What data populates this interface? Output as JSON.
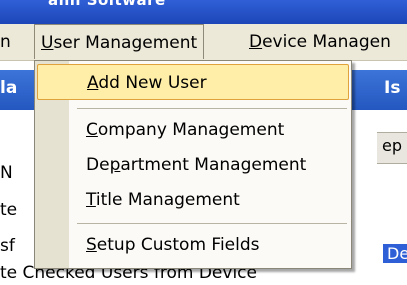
{
  "window": {
    "title_fragment": "ann Soitware"
  },
  "menubar": {
    "left_fragment": "n",
    "user_management": {
      "access": "U",
      "rest": "ser Management"
    },
    "device_management": {
      "access": "D",
      "rest": "evice Managen"
    }
  },
  "background": {
    "band_left": "la",
    "band_right": "Is",
    "row_n": "N",
    "row_te": "te",
    "row_sf": "sf",
    "row_ep": "ep",
    "row_de": "De",
    "bottom_text": "te Checked Users from Device"
  },
  "dropdown": {
    "items": [
      {
        "access": "A",
        "rest": "dd New User"
      },
      {
        "access": "C",
        "rest": "ompany Management"
      },
      {
        "pre": "De",
        "access": "p",
        "rest": "artment Management"
      },
      {
        "access": "T",
        "rest": "itle Management"
      },
      {
        "access": "S",
        "rest": "etup Custom Fields"
      }
    ]
  },
  "colors": {
    "title_blue": "#1d47b8",
    "highlight_fill": "#ffeea8",
    "highlight_border": "#e0a23a",
    "menu_bg": "#ece9d8"
  }
}
